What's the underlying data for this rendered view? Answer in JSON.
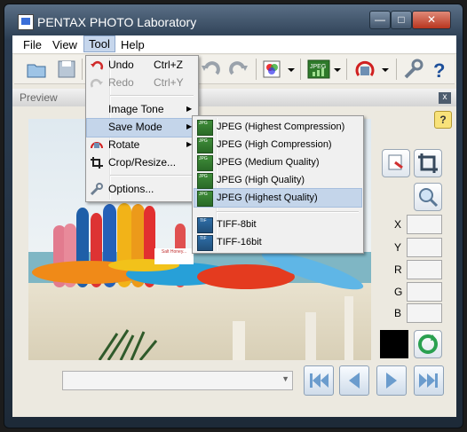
{
  "window": {
    "title": "PENTAX PHOTO Laboratory",
    "min_glyph": "—",
    "max_glyph": "□",
    "close_glyph": "✕"
  },
  "menubar": [
    "File",
    "View",
    "Tool",
    "Help"
  ],
  "preview": {
    "label": "Preview",
    "close_glyph": "x",
    "help_glyph": "?"
  },
  "tool_menu": {
    "undo": {
      "label": "Undo",
      "shortcut": "Ctrl+Z"
    },
    "redo": {
      "label": "Redo",
      "shortcut": "Ctrl+Y"
    },
    "image_tone": "Image Tone",
    "save_mode": "Save Mode",
    "rotate": "Rotate",
    "crop_resize": "Crop/Resize...",
    "options": "Options..."
  },
  "save_mode_menu": [
    "JPEG (Highest Compression)",
    "JPEG (High Compression)",
    "JPEG (Medium Quality)",
    "JPEG (High Quality)",
    "JPEG (Highest Quality)",
    "TIFF-8bit",
    "TIFF-16bit"
  ],
  "coords": [
    "X",
    "Y",
    "R",
    "G",
    "B"
  ],
  "sign_text": "Salt Honey..."
}
